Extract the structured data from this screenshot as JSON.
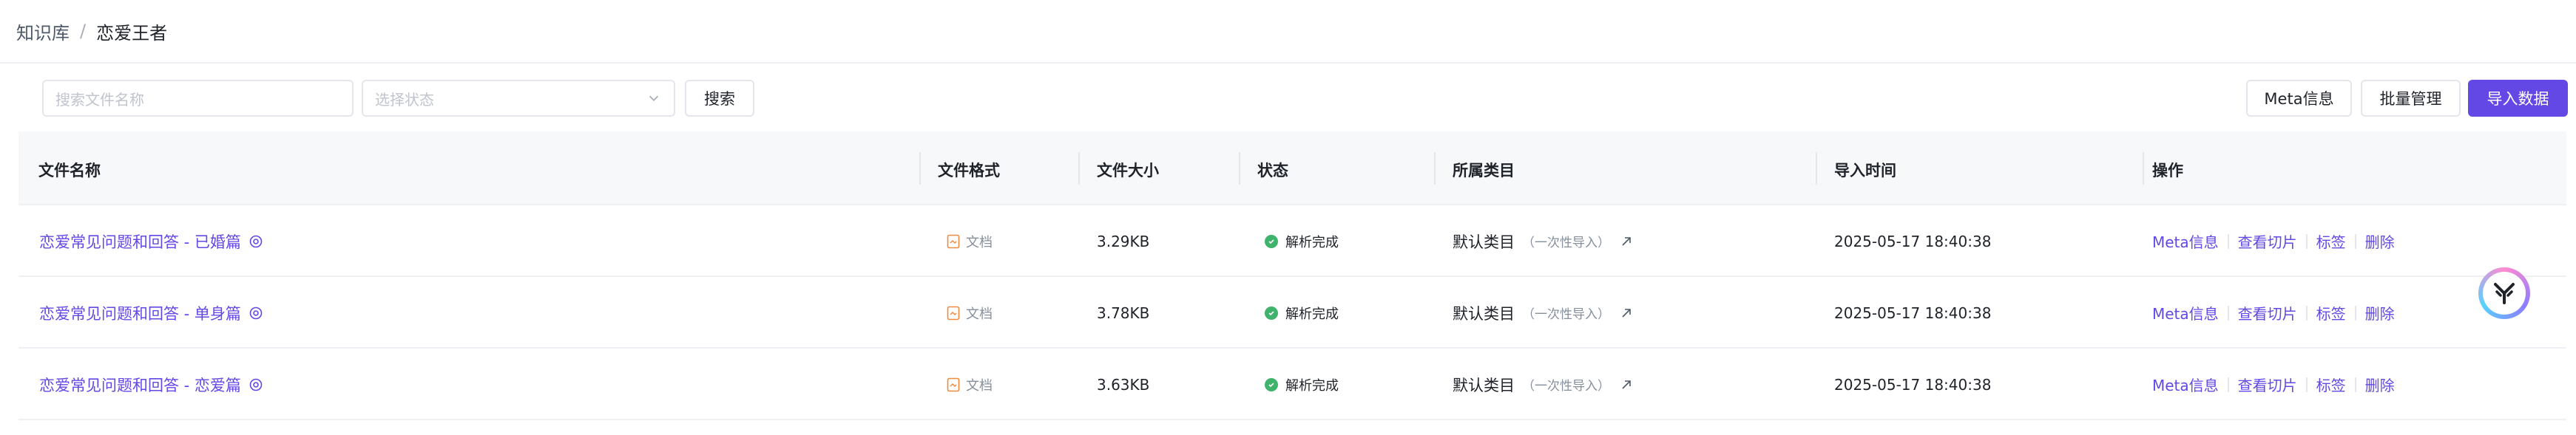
{
  "breadcrumb": {
    "root": "知识库",
    "separator": "/",
    "current": "恋爱王者"
  },
  "toolbar": {
    "search_placeholder": "搜索文件名称",
    "status_placeholder": "选择状态",
    "search_label": "搜索",
    "meta_label": "Meta信息",
    "batch_label": "批量管理",
    "import_label": "导入数据"
  },
  "colors": {
    "accent": "#6448e6",
    "success": "#3fb26b",
    "file_icon": "#f08a3c"
  },
  "table": {
    "headers": [
      "文件名称",
      "文件格式",
      "文件大小",
      "状态",
      "所属类目",
      "导入时间",
      "操作"
    ],
    "rows": [
      {
        "name": "恋爱常见问题和回答 - 已婚篇",
        "format": "文档",
        "size": "3.29KB",
        "status": "解析完成",
        "category": "默认类目",
        "category_note": "（一次性导入）",
        "time": "2025-05-17 18:40:38"
      },
      {
        "name": "恋爱常见问题和回答 - 单身篇",
        "format": "文档",
        "size": "3.78KB",
        "status": "解析完成",
        "category": "默认类目",
        "category_note": "（一次性导入）",
        "time": "2025-05-17 18:40:38"
      },
      {
        "name": "恋爱常见问题和回答 - 恋爱篇",
        "format": "文档",
        "size": "3.63KB",
        "status": "解析完成",
        "category": "默认类目",
        "category_note": "（一次性导入）",
        "time": "2025-05-17 18:40:38"
      }
    ],
    "actions": {
      "meta": "Meta信息",
      "slices": "查看切片",
      "tags": "标签",
      "delete": "删除"
    }
  }
}
